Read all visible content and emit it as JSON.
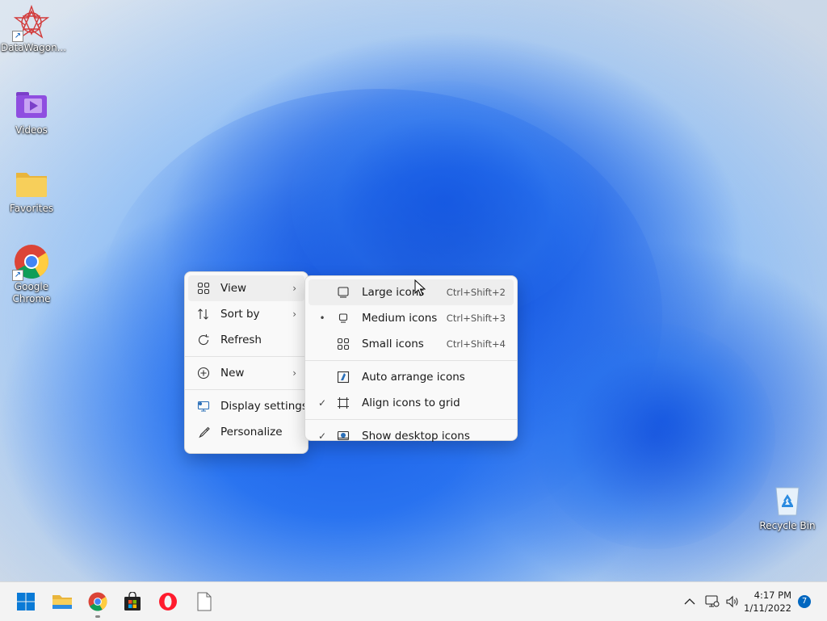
{
  "desktop": {
    "icons": [
      {
        "label": "DataWagon...",
        "icon": "datawagon-app-icon"
      },
      {
        "label": "Videos",
        "icon": "videos-folder-icon"
      },
      {
        "label": "Favorites",
        "icon": "folder-icon"
      },
      {
        "label": "Google Chrome",
        "icon": "chrome-icon"
      },
      {
        "label": "Recycle Bin",
        "icon": "recycle-bin-icon"
      }
    ]
  },
  "context_menu": {
    "items": [
      {
        "label": "View",
        "icon": "grid-icon",
        "submenu": true
      },
      {
        "label": "Sort by",
        "icon": "sort-icon",
        "submenu": true
      },
      {
        "label": "Refresh",
        "icon": "refresh-icon"
      },
      {
        "label": "New",
        "icon": "plus-circle-icon",
        "submenu": true
      },
      {
        "label": "Display settings",
        "icon": "display-icon"
      },
      {
        "label": "Personalize",
        "icon": "brush-icon"
      }
    ]
  },
  "view_submenu": {
    "items": [
      {
        "label": "Large icons",
        "shortcut": "Ctrl+Shift+2",
        "mark": ""
      },
      {
        "label": "Medium icons",
        "shortcut": "Ctrl+Shift+3",
        "mark": "•"
      },
      {
        "label": "Small icons",
        "shortcut": "Ctrl+Shift+4",
        "mark": ""
      },
      {
        "label": "Auto arrange icons",
        "mark": ""
      },
      {
        "label": "Align icons to grid",
        "mark": "✓"
      },
      {
        "label": "Show desktop icons",
        "mark": "✓"
      }
    ]
  },
  "taskbar": {
    "apps": [
      "start-button",
      "file-explorer",
      "chrome",
      "microsoft-store",
      "opera",
      "notepad"
    ],
    "time": "4:17 PM",
    "date": "1/11/2022",
    "notification_count": "7"
  },
  "colors": {
    "accent": "#0067c0",
    "menu_bg": "#f9f9f9",
    "taskbar_bg": "#f3f3f3"
  }
}
